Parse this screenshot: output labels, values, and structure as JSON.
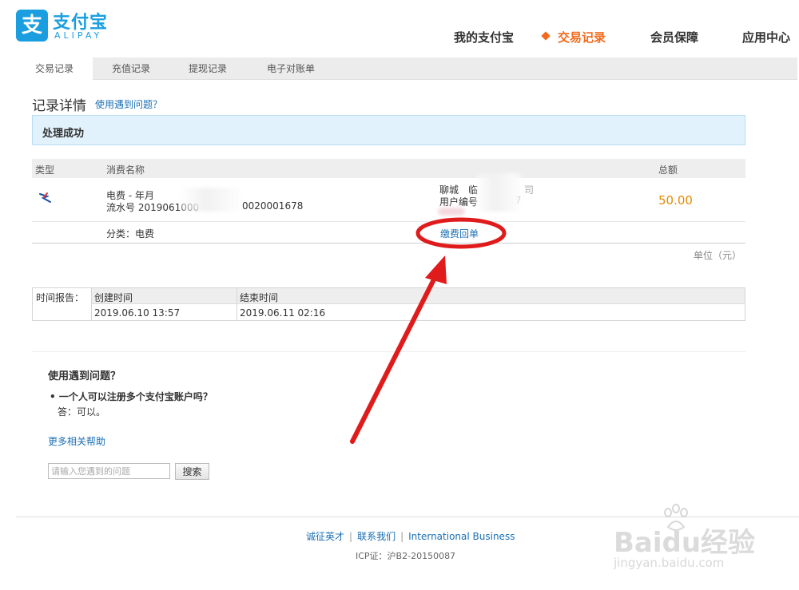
{
  "header": {
    "logo_char": "支",
    "logo_cn": "支付宝",
    "logo_en": "ALIPAY",
    "nav": [
      "我的支付宝",
      "交易记录",
      "会员保障",
      "应用中心"
    ],
    "active_color": "#f26b1d"
  },
  "subnav": {
    "tabs": [
      "交易记录",
      "充值记录",
      "提现记录",
      "电子对账单"
    ]
  },
  "record": {
    "title": "记录详情",
    "help_link": "使用遇到问题？",
    "status": "处理成功",
    "columns": [
      "类型",
      "消费名称",
      "总额"
    ],
    "item_name": "电费 - 年月",
    "serial_prefix": "流水号 2019061000",
    "serial_suffix": "0020001678",
    "org": "聊城　临",
    "org_suffix": "司",
    "user_no_label": "用户编号",
    "user_no_partial": "0017",
    "amount": "50.00",
    "category": "分类：电费",
    "receipt_link": "缴费回单",
    "unit": "单位（元）"
  },
  "time_report": {
    "label": "时间报告：",
    "created_header": "创建时间",
    "ended_header": "结束时间",
    "created": "2019.06.10 13:57",
    "ended": "2019.06.11 02:16"
  },
  "faq": {
    "title": "使用遇到问题？",
    "question": "• 一个人可以注册多个支付宝账户吗？",
    "answer": "答：可以。",
    "more": "更多相关帮助",
    "search_placeholder": "请输入您遇到的问题",
    "search_button": "搜索"
  },
  "footer": {
    "links": [
      "诚征英才",
      "联系我们",
      "International Business"
    ],
    "icp": "ICP证：沪B2-20150087"
  },
  "watermark": {
    "brand": "Baidu经验",
    "url": "jingyan.baidu.com"
  }
}
